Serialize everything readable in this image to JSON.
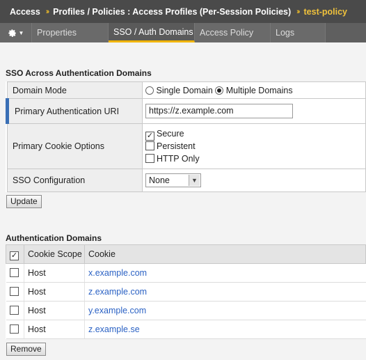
{
  "breadcrumb": {
    "items": [
      "Access",
      "Profiles / Policies : Access Profiles (Per-Session Policies)"
    ],
    "separator": "››",
    "current": "test-policy"
  },
  "tabs": [
    {
      "label": "Properties",
      "active": false
    },
    {
      "label": "SSO / Auth Domains",
      "active": true
    },
    {
      "label": "Access Policy",
      "active": false
    },
    {
      "label": "Logs",
      "active": false
    }
  ],
  "sso_section": {
    "title": "SSO Across Authentication Domains",
    "domain_mode": {
      "label": "Domain Mode",
      "options": [
        "Single Domain",
        "Multiple Domains"
      ],
      "selected": "Multiple Domains"
    },
    "primary_uri": {
      "label": "Primary Authentication URI",
      "value": "https://z.example.com"
    },
    "cookie_options": {
      "label": "Primary Cookie Options",
      "options": [
        {
          "label": "Secure",
          "checked": true
        },
        {
          "label": "Persistent",
          "checked": false
        },
        {
          "label": "HTTP Only",
          "checked": false
        }
      ]
    },
    "sso_config": {
      "label": "SSO Configuration",
      "value": "None"
    },
    "update_label": "Update"
  },
  "auth_domains": {
    "title": "Authentication Domains",
    "columns": [
      "Cookie Scope",
      "Cookie"
    ],
    "rows": [
      {
        "scope": "Host",
        "cookie": "x.example.com"
      },
      {
        "scope": "Host",
        "cookie": "z.example.com"
      },
      {
        "scope": "Host",
        "cookie": "y.example.com"
      },
      {
        "scope": "Host",
        "cookie": "z.example.se"
      }
    ],
    "remove_label": "Remove"
  },
  "icons": {
    "gear": "gear-icon",
    "dropdown": "chevron-down-icon",
    "check": "checkmark-icon"
  },
  "colors": {
    "accent": "#f0b400",
    "link": "#2b62c4",
    "highlight_bar": "#3a6fb5"
  }
}
